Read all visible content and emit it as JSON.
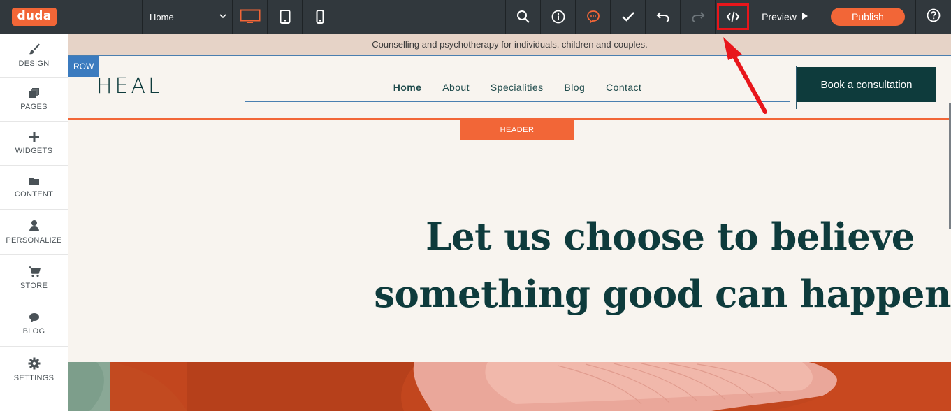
{
  "toolbar": {
    "logo_text": "duda",
    "page_select_value": "Home",
    "preview_label": "Preview",
    "publish_label": "Publish",
    "icons": [
      "desktop-icon",
      "tablet-icon",
      "mobile-icon",
      "search-icon",
      "info-icon",
      "comments-icon",
      "checkmark-icon",
      "undo-icon",
      "redo-icon",
      "code-icon",
      "play-icon",
      "help-icon"
    ],
    "accent_color": "#f26637",
    "highlight_color": "#e8161b"
  },
  "sidebar": {
    "items": [
      {
        "label": "DESIGN",
        "icon": "brush-icon"
      },
      {
        "label": "PAGES",
        "icon": "pages-icon"
      },
      {
        "label": "WIDGETS",
        "icon": "plus-icon"
      },
      {
        "label": "CONTENT",
        "icon": "folder-icon"
      },
      {
        "label": "PERSONALIZE",
        "icon": "person-icon"
      },
      {
        "label": "STORE",
        "icon": "cart-icon"
      },
      {
        "label": "BLOG",
        "icon": "speech-bubble-icon"
      },
      {
        "label": "SETTINGS",
        "icon": "gear-icon"
      }
    ]
  },
  "site": {
    "announcement": "Counselling and psychotherapy for individuals, children and couples.",
    "row_tag": "ROW",
    "brand": "HEAL",
    "nav": [
      "Home",
      "About",
      "Specialities",
      "Blog",
      "Contact"
    ],
    "cta_label": "Book a consultation",
    "header_tag": "HEADER",
    "hero_line1": "Let us choose to believe",
    "hero_line2": "something good can happen",
    "brand_color": "#0e3b3c"
  }
}
